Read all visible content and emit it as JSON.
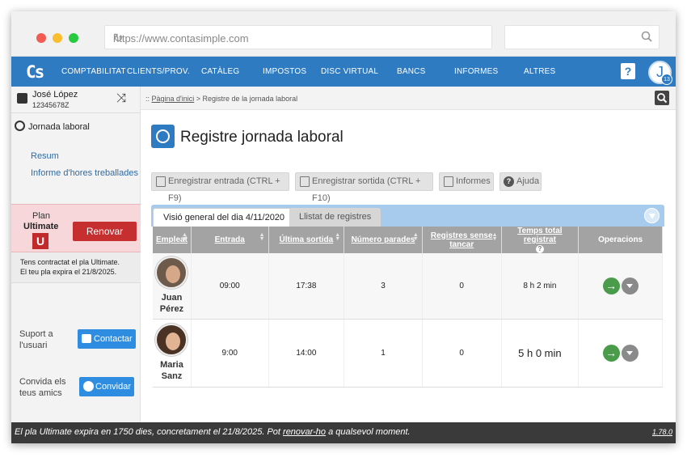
{
  "browser": {
    "url": "https://www.contasimple.com",
    "search_value": ""
  },
  "nav": {
    "logo": "Cs",
    "items": [
      "COMPTABILITAT",
      "CLIENTS/PROV.",
      "CATÀLEG",
      "IMPOSTOS",
      "DISC VIRTUAL",
      "BANCS",
      "INFORMES",
      "ALTRES"
    ],
    "help": "?",
    "avatar_letter": "J",
    "avatar_badge": "13"
  },
  "user": {
    "name": "José López",
    "nif": "12345678Z"
  },
  "breadcrumb": {
    "home": "Pàgina d'inici",
    "current": " > Registre de la jornada laboral",
    "prefix": ":: "
  },
  "sidebar": {
    "section_title": "Jornada laboral",
    "links": [
      "Resum",
      "Informe d'hores treballades"
    ],
    "plan": {
      "label": "Plan",
      "name": "Ultimate",
      "logo": "U",
      "renew_button": "Renovar"
    },
    "plan_info": [
      "Tens contractat el pla Ultimate.",
      "El teu pla expira el 21/8/2025."
    ],
    "support": {
      "label_1": "Suport a",
      "label_2": "l'usuari",
      "button": "Contactar"
    },
    "invite": {
      "label_1": "Convida els",
      "label_2": "teus amics",
      "button": "Convidar"
    }
  },
  "main": {
    "title": "Registre jornada laboral",
    "toolbar": {
      "entry": "Enregistrar entrada (CTRL + F9)",
      "exit": "Enregistrar sortida (CTRL + F10)",
      "reports": "Informes",
      "help": "Ajuda"
    },
    "tabs": [
      "Visió general del dia 4/11/2020",
      "Llistat de registres"
    ],
    "table": {
      "headers": [
        "Empleat",
        "Entrada",
        "Última sortida",
        "Número parades",
        "Registres sense tancar",
        "Temps total registrat",
        "Operacions"
      ],
      "rows": [
        {
          "first": "Juan",
          "last": "Pérez",
          "entrada": "09:00",
          "sortida": "17:38",
          "parades": "3",
          "sense_tancar": "0",
          "temps": "8 h 2 min"
        },
        {
          "first": "Maria",
          "last": "Sanz",
          "entrada": "9:00",
          "sortida": "14:00",
          "parades": "1",
          "sense_tancar": "0",
          "temps": "5 h 0 min"
        }
      ]
    }
  },
  "footer": {
    "before": "El pla Ultimate expira en 1750 dies, concretament el 21/8/2025. Pot ",
    "link": "renovar-ho",
    "after": " a qualsevol moment.",
    "version": "1.78.0"
  },
  "colors": {
    "brand": "#2e7bc2",
    "renew": "#c62f2f",
    "go": "#4a9c4b"
  }
}
